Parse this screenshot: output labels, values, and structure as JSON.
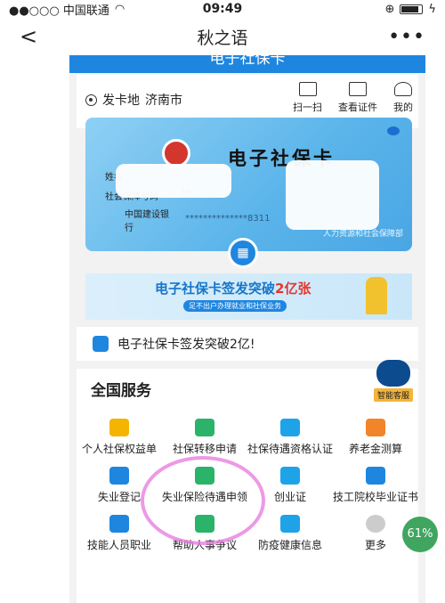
{
  "status_bar": {
    "carrier": "●●○○○ 中国联通",
    "time": "09:49"
  },
  "nav": {
    "back": "<",
    "title": "秋之语",
    "more": "•••"
  },
  "page_header": "电子社保卡",
  "location": {
    "label": "发卡地",
    "city": "济南市"
  },
  "actions": [
    {
      "label": "扫一扫"
    },
    {
      "label": "查看证件"
    },
    {
      "label": "我的"
    }
  ],
  "card": {
    "title": "电子社保卡",
    "name_label": "姓名",
    "id_label": "社会保障号码",
    "id_mask": "**",
    "bank_label": "中国建设银行",
    "bank_number": "**************8311",
    "footer": "人力资源和社会保障部"
  },
  "banner": {
    "text": "电子社保卡签发突破",
    "highlight": "2亿张",
    "sub": "足不出户办理就业和社保业务"
  },
  "notice": "电子社保卡签发突破2亿!",
  "service": {
    "title": "全国服务",
    "assistant": "智能客服",
    "items": [
      {
        "label": "个人社保权益单",
        "color": "#f4b400"
      },
      {
        "label": "社保转移申请",
        "color": "#2bb36a"
      },
      {
        "label": "社保待遇资格认证",
        "color": "#1fa3e8"
      },
      {
        "label": "养老金测算",
        "color": "#f2842a"
      },
      {
        "label": "失业登记",
        "color": "#1f86e0"
      },
      {
        "label": "失业保险待遇申领",
        "color": "#2bb36a"
      },
      {
        "label": "创业证",
        "color": "#1fa3e8"
      },
      {
        "label": "技工院校毕业证书",
        "color": "#1f86e0"
      },
      {
        "label": "技能人员职业",
        "color": "#1f86e0"
      },
      {
        "label": "帮助人事争议",
        "color": "#2bb36a"
      },
      {
        "label": "防疫健康信息",
        "color": "#1fa3e8"
      },
      {
        "label": "更多",
        "color": "#cccccc"
      }
    ]
  },
  "overlay": {
    "percent": "61%"
  }
}
